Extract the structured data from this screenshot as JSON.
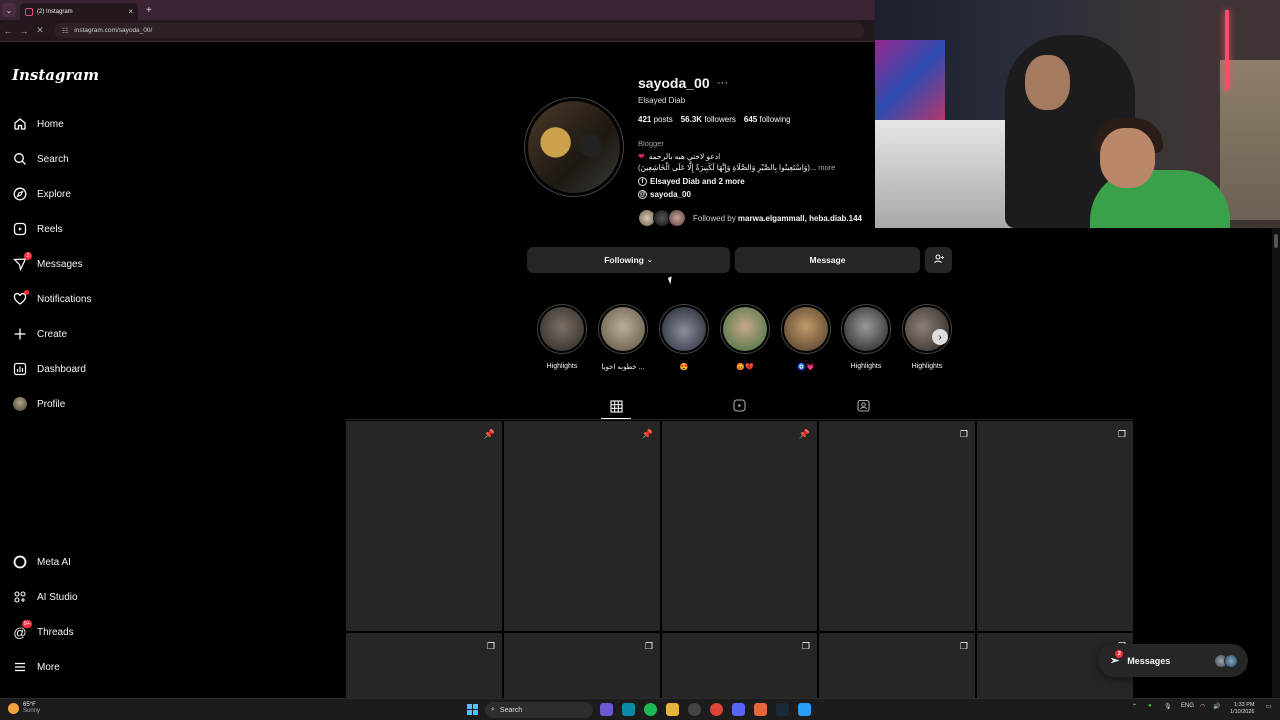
{
  "browser": {
    "tab_title": "(2) Instagram",
    "url": "instagram.com/sayoda_00/"
  },
  "sidebar": {
    "logo": "Instagram",
    "items": [
      {
        "label": "Home"
      },
      {
        "label": "Search"
      },
      {
        "label": "Explore"
      },
      {
        "label": "Reels"
      },
      {
        "label": "Messages",
        "badge": "2"
      },
      {
        "label": "Notifications"
      },
      {
        "label": "Create"
      },
      {
        "label": "Dashboard"
      },
      {
        "label": "Profile"
      }
    ],
    "bottom_items": [
      {
        "label": "Meta AI"
      },
      {
        "label": "AI Studio"
      },
      {
        "label": "Threads",
        "badge": "9+"
      },
      {
        "label": "More"
      }
    ]
  },
  "profile": {
    "username": "sayoda_00",
    "options_glyph": "···",
    "full_name": "Elsayed Diab",
    "posts_count": "421",
    "posts_label": "posts",
    "followers_count": "56.3K",
    "followers_label": "followers",
    "following_count": "645",
    "following_label": "following",
    "category": "Blogger",
    "bio_line1": "ادعو لاختي هبه بالرحمه",
    "bio_line2": "(وَاسْتَعِينُوا بِالصَّبْرِ وَالصَّلَاةِ وَإِنَّهَا لَكَبِيرَةٌ إِلَّا عَلَى الْخَاشِعِينَ)...",
    "bio_more": "more",
    "link_text": "Elsayed Diab and 2 more",
    "threads_handle": "sayoda_00",
    "followed_by_prefix": "Followed by",
    "followed_by_names": "marwa.elgammall, heba.diab.144"
  },
  "actions": {
    "following": "Following",
    "message": "Message"
  },
  "highlights": [
    {
      "label": "Highlights"
    },
    {
      "label": "خطوبه اخويا ..."
    },
    {
      "label": "😍"
    },
    {
      "label": "😡💔"
    },
    {
      "label": "🧿💗"
    },
    {
      "label": "Highlights"
    },
    {
      "label": "Highlights"
    }
  ],
  "floating_messages": {
    "label": "Messages",
    "badge": "2"
  },
  "taskbar": {
    "weather_temp": "65°F",
    "weather_desc": "Sunny",
    "search_label": "Search",
    "lang": "ENG",
    "time": "1:33 PM",
    "date": "1/10/2026"
  },
  "colors": {
    "background": "#000000",
    "button": "#262626",
    "badge": "#ff3040"
  }
}
